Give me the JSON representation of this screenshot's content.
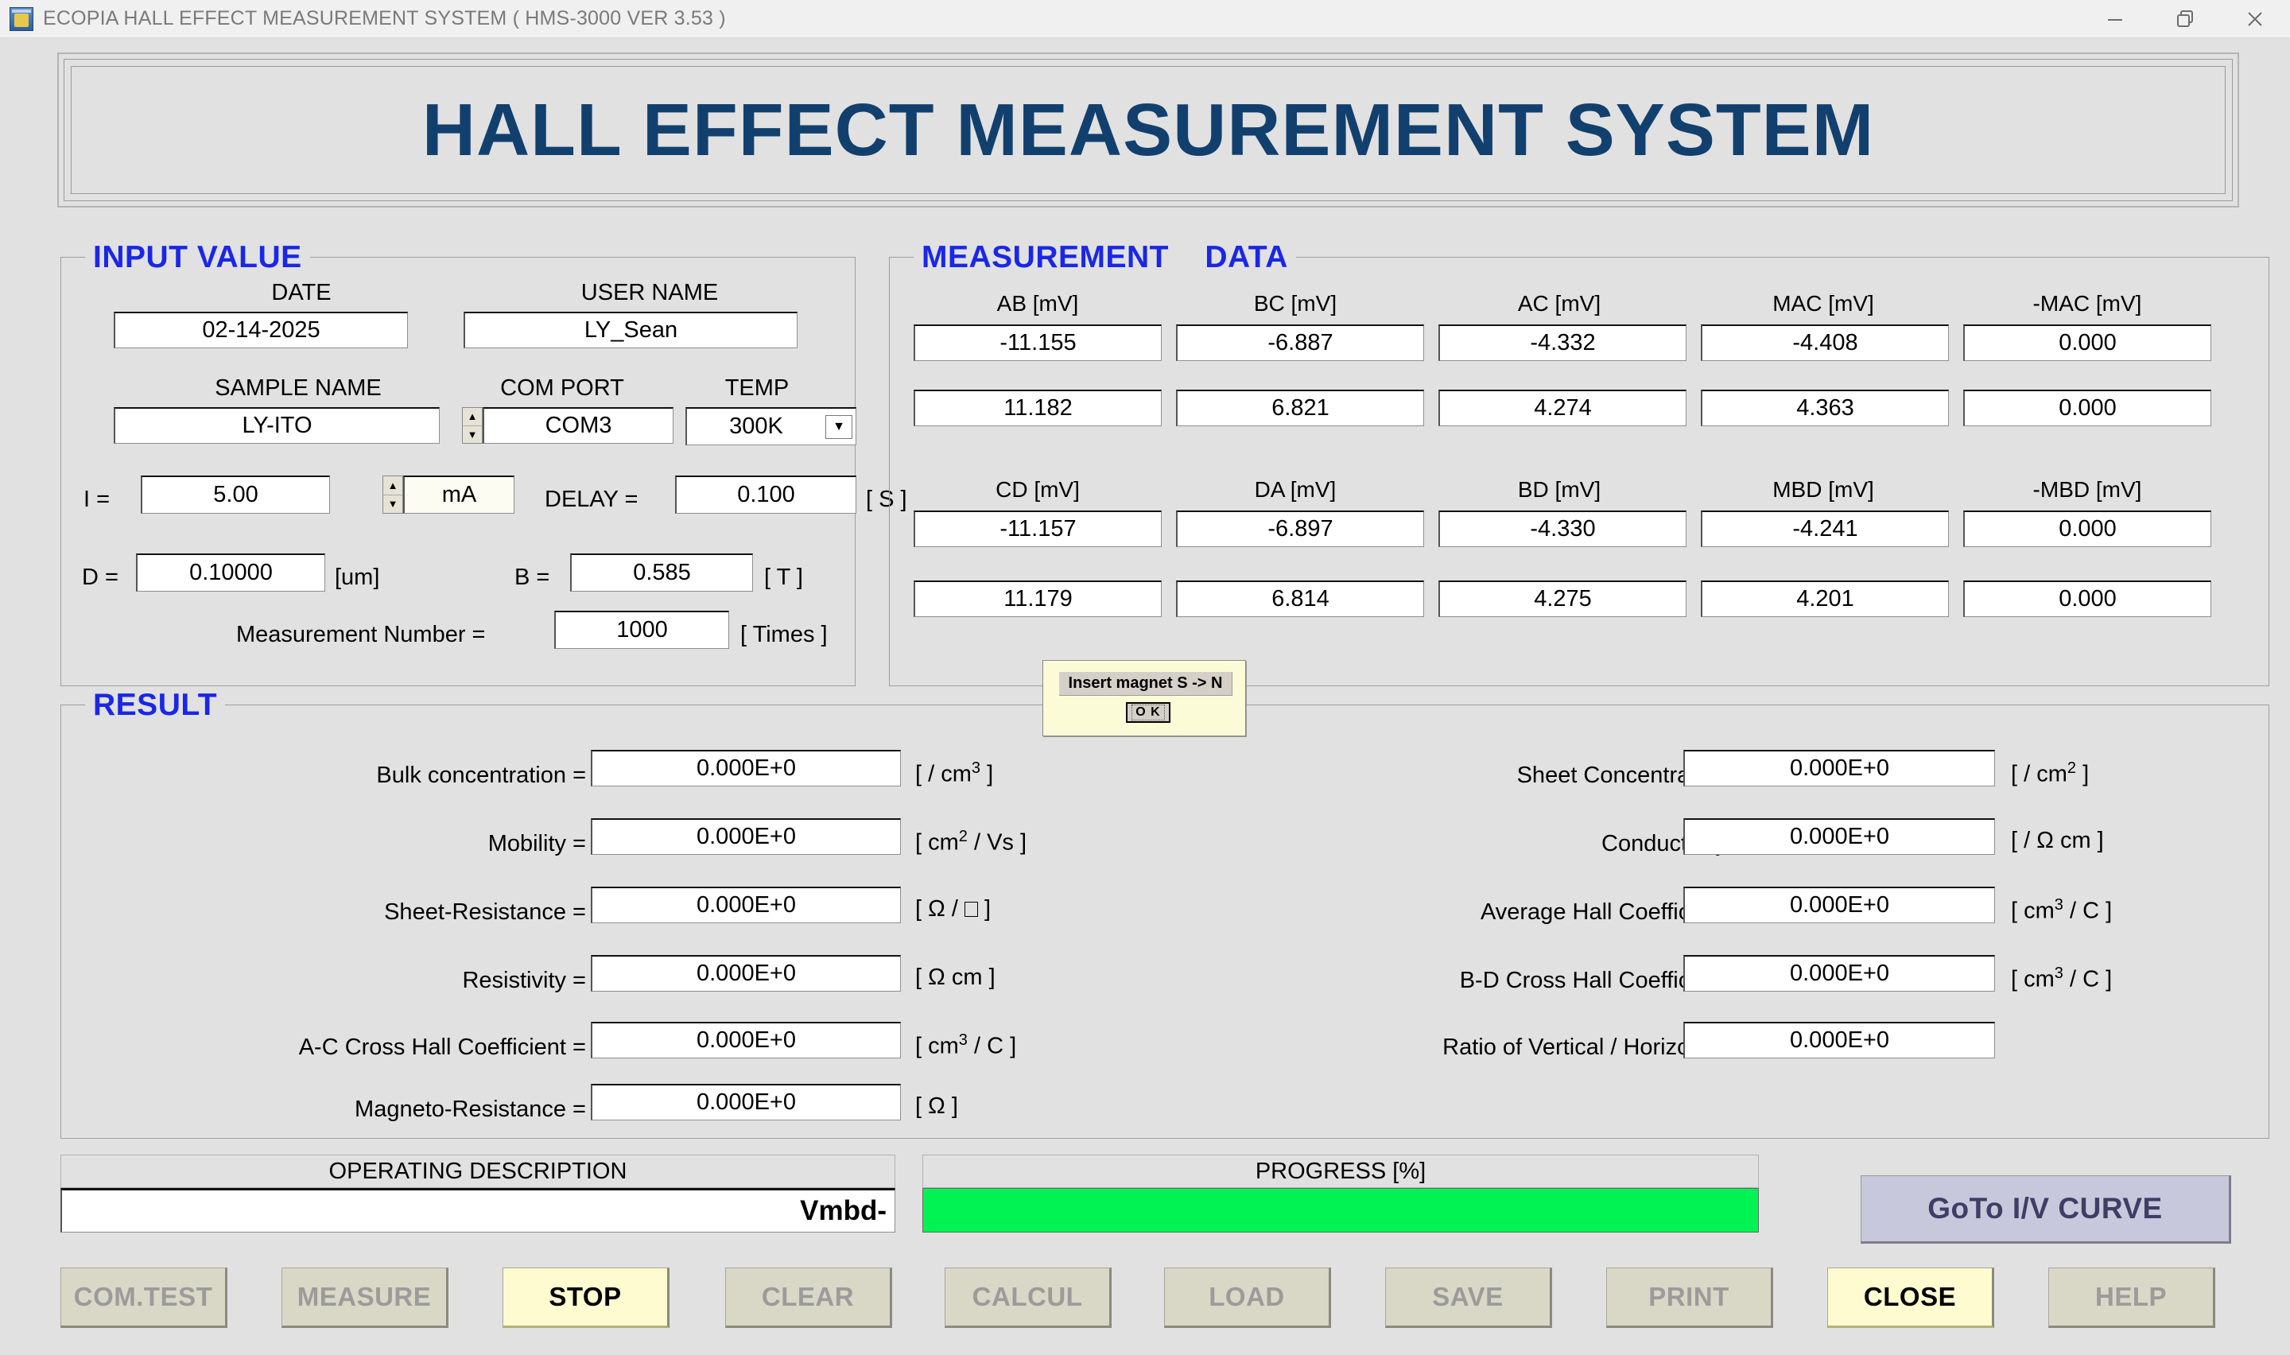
{
  "window": {
    "title": "ECOPIA HALL EFFECT MEASUREMENT SYSTEM ( HMS-3000  VER 3.53 )",
    "controls": {
      "minimize": "minimize-icon",
      "restore": "restore-icon",
      "close": "close-icon"
    }
  },
  "banner": {
    "text": "HALL EFFECT MEASUREMENT SYSTEM"
  },
  "input_value": {
    "legend": "INPUT VALUE",
    "date_label": "DATE",
    "date_value": "02-14-2025",
    "user_name_label": "USER NAME",
    "user_name_value": "LY_Sean",
    "sample_name_label": "SAMPLE NAME",
    "sample_name_value": "LY-ITO",
    "com_port_label": "COM PORT",
    "com_port_value": "COM3",
    "temp_label": "TEMP",
    "temp_value": "300K",
    "current_label": "I  =",
    "current_value": "5.00",
    "current_unit": "mA",
    "delay_label": "DELAY =",
    "delay_value": "0.100",
    "delay_unit": "[ S ]",
    "thickness_label": "D =",
    "thickness_value": "0.10000",
    "thickness_unit": "[um]",
    "field_label": "B =",
    "field_value": "0.585",
    "field_unit": "[ T ]",
    "meas_number_label": "Measurement Number  =",
    "meas_number_value": "1000",
    "meas_number_unit": "[ Times ]"
  },
  "measurement": {
    "legend_1": "MEASUREMENT",
    "legend_2": "DATA",
    "block1": {
      "headers": [
        "AB [mV]",
        "BC [mV]",
        "AC [mV]",
        "MAC [mV]",
        "-MAC [mV]"
      ],
      "row1": [
        "-11.155",
        "-6.887",
        "-4.332",
        "-4.408",
        "0.000"
      ],
      "row2": [
        "11.182",
        "6.821",
        "4.274",
        "4.363",
        "0.000"
      ]
    },
    "block2": {
      "headers": [
        "CD [mV]",
        "DA [mV]",
        "BD [mV]",
        "MBD [mV]",
        "-MBD [mV]"
      ],
      "row1": [
        "-11.157",
        "-6.897",
        "-4.330",
        "-4.241",
        "0.000"
      ],
      "row2": [
        "11.179",
        "6.814",
        "4.275",
        "4.201",
        "0.000"
      ]
    }
  },
  "dialog": {
    "message": "Insert magnet S -> N",
    "ok_label": "O K"
  },
  "result": {
    "legend": "RESULT",
    "left": [
      {
        "label": "Bulk concentration =",
        "value": "0.000E+0",
        "unit_pre": "[ / cm",
        "unit_sup": "3",
        "unit_post": "]"
      },
      {
        "label": "Mobility =",
        "value": "0.000E+0",
        "unit_pre": "[ cm",
        "unit_sup": "2",
        "unit_post": "/ Vs ]"
      },
      {
        "label": "Sheet-Resistance =",
        "value": "0.000E+0",
        "unit_pre": "[ Ω  /",
        "unit_sup": "",
        "unit_post": "]",
        "square": true
      },
      {
        "label": "Resistivity =",
        "value": "0.000E+0",
        "unit_pre": "[ Ω cm ]",
        "unit_sup": "",
        "unit_post": ""
      },
      {
        "label": "A-C Cross Hall Coefficient =",
        "value": "0.000E+0",
        "unit_pre": "[ cm",
        "unit_sup": "3",
        "unit_post": "/ C ]"
      },
      {
        "label": "Magneto-Resistance =",
        "value": "0.000E+0",
        "unit_pre": "[ Ω ]",
        "unit_sup": "",
        "unit_post": ""
      }
    ],
    "right": [
      {
        "label": "Sheet Concentration =",
        "value": "0.000E+0",
        "unit_pre": "[ / cm",
        "unit_sup": "2",
        "unit_post": "]"
      },
      {
        "label": "Conductivity =",
        "value": "0.000E+0",
        "unit_pre": "[ /  Ω cm ]",
        "unit_sup": "",
        "unit_post": ""
      },
      {
        "label": "Average Hall Coefficient =",
        "value": "0.000E+0",
        "unit_pre": "[ cm",
        "unit_sup": "3",
        "unit_post": "/ C ]"
      },
      {
        "label": "B-D Cross Hall Coefficient =",
        "value": "0.000E+0",
        "unit_pre": "[ cm",
        "unit_sup": "3",
        "unit_post": "/ C ]"
      },
      {
        "label": "Ratio of Vertical / Horizontal =",
        "value": "0.000E+0",
        "unit_pre": "",
        "unit_sup": "",
        "unit_post": ""
      }
    ]
  },
  "bottom": {
    "operating_description_label": "OPERATING   DESCRIPTION",
    "operating_description_value": "Vmbd-",
    "progress_label": "PROGRESS [%]",
    "progress_percent": 100,
    "progress_color": "#00f253",
    "goto_iv_curve_label": "GoTo I/V CURVE"
  },
  "buttons": [
    {
      "label": "COM.TEST",
      "active": false
    },
    {
      "label": "MEASURE",
      "active": false
    },
    {
      "label": "STOP",
      "active": true
    },
    {
      "label": "CLEAR",
      "active": false
    },
    {
      "label": "CALCUL",
      "active": false
    },
    {
      "label": "LOAD",
      "active": false
    },
    {
      "label": "SAVE",
      "active": false
    },
    {
      "label": "PRINT",
      "active": false
    },
    {
      "label": "CLOSE",
      "active": true
    },
    {
      "label": "HELP",
      "active": false
    }
  ]
}
